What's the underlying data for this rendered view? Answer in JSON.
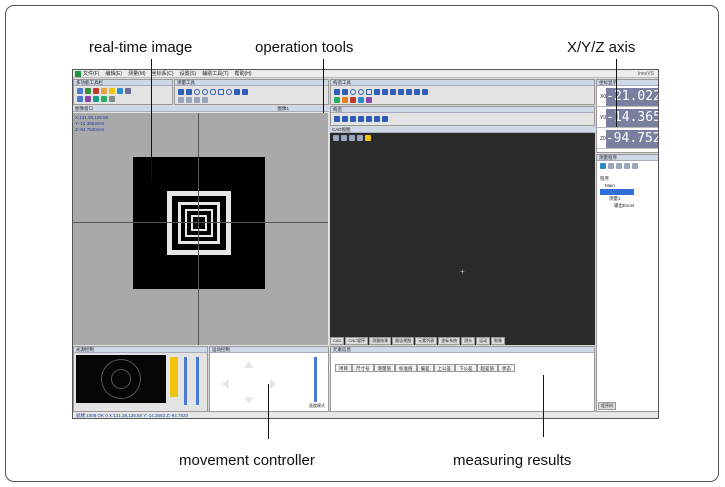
{
  "callouts": {
    "realtime": "real-time image",
    "tools": "operation tools",
    "axis": "X/Y/Z axis",
    "movement": "movement controller",
    "results": "measuring results"
  },
  "app": {
    "menu": [
      "文件(F)",
      "编辑(E)",
      "测量(M)",
      "坐标系(C)",
      "设置(S)",
      "辅助工具(T)",
      "帮助(H)"
    ],
    "title_right": "InnoVS"
  },
  "panels": {
    "left_tools": "多功能工具栏",
    "measure_tools": "测量工具",
    "right_tools": "构造工具",
    "construct": "构造",
    "dro": "坐标显示",
    "camera_tab": "图像窗口",
    "zoom_label": "图像1",
    "cad": "CAD视图",
    "program": "测量程序",
    "light": "光源控制",
    "motion": "运动控制",
    "results": "元素信息",
    "program_tab": "程序树"
  },
  "overlay_text": [
    "X:131.38,128.58",
    "Y:-14.3653mm",
    "Z:-94.7520mm"
  ],
  "dro": {
    "x_label": "X0",
    "x_value": "-21.0223",
    "x_unit": "mm",
    "y_label": "Y0",
    "y_value": "-14.3653",
    "y_unit": "mm",
    "z_label": "Z0",
    "z_value": "-94.7520",
    "z_unit": "mm"
  },
  "program_tree": [
    "程序",
    "Main",
    "测量1",
    "输出Excel"
  ],
  "results_columns": [
    "项目",
    "尺寸号",
    "测量值",
    "标准值",
    "偏差",
    "上公差",
    "下公差",
    "超差值",
    "状态"
  ],
  "bottom_tabs": [
    "CAD",
    "CNC程序",
    "测量结果",
    "报告视图",
    "元素列表",
    "坐标系统",
    "测头",
    "运动",
    "影像"
  ],
  "speed_label": "速度模式",
  "status": "就绪 1008  OK  0  X:131.38,128.58  Y:-14.3653  Z:-94.7520"
}
